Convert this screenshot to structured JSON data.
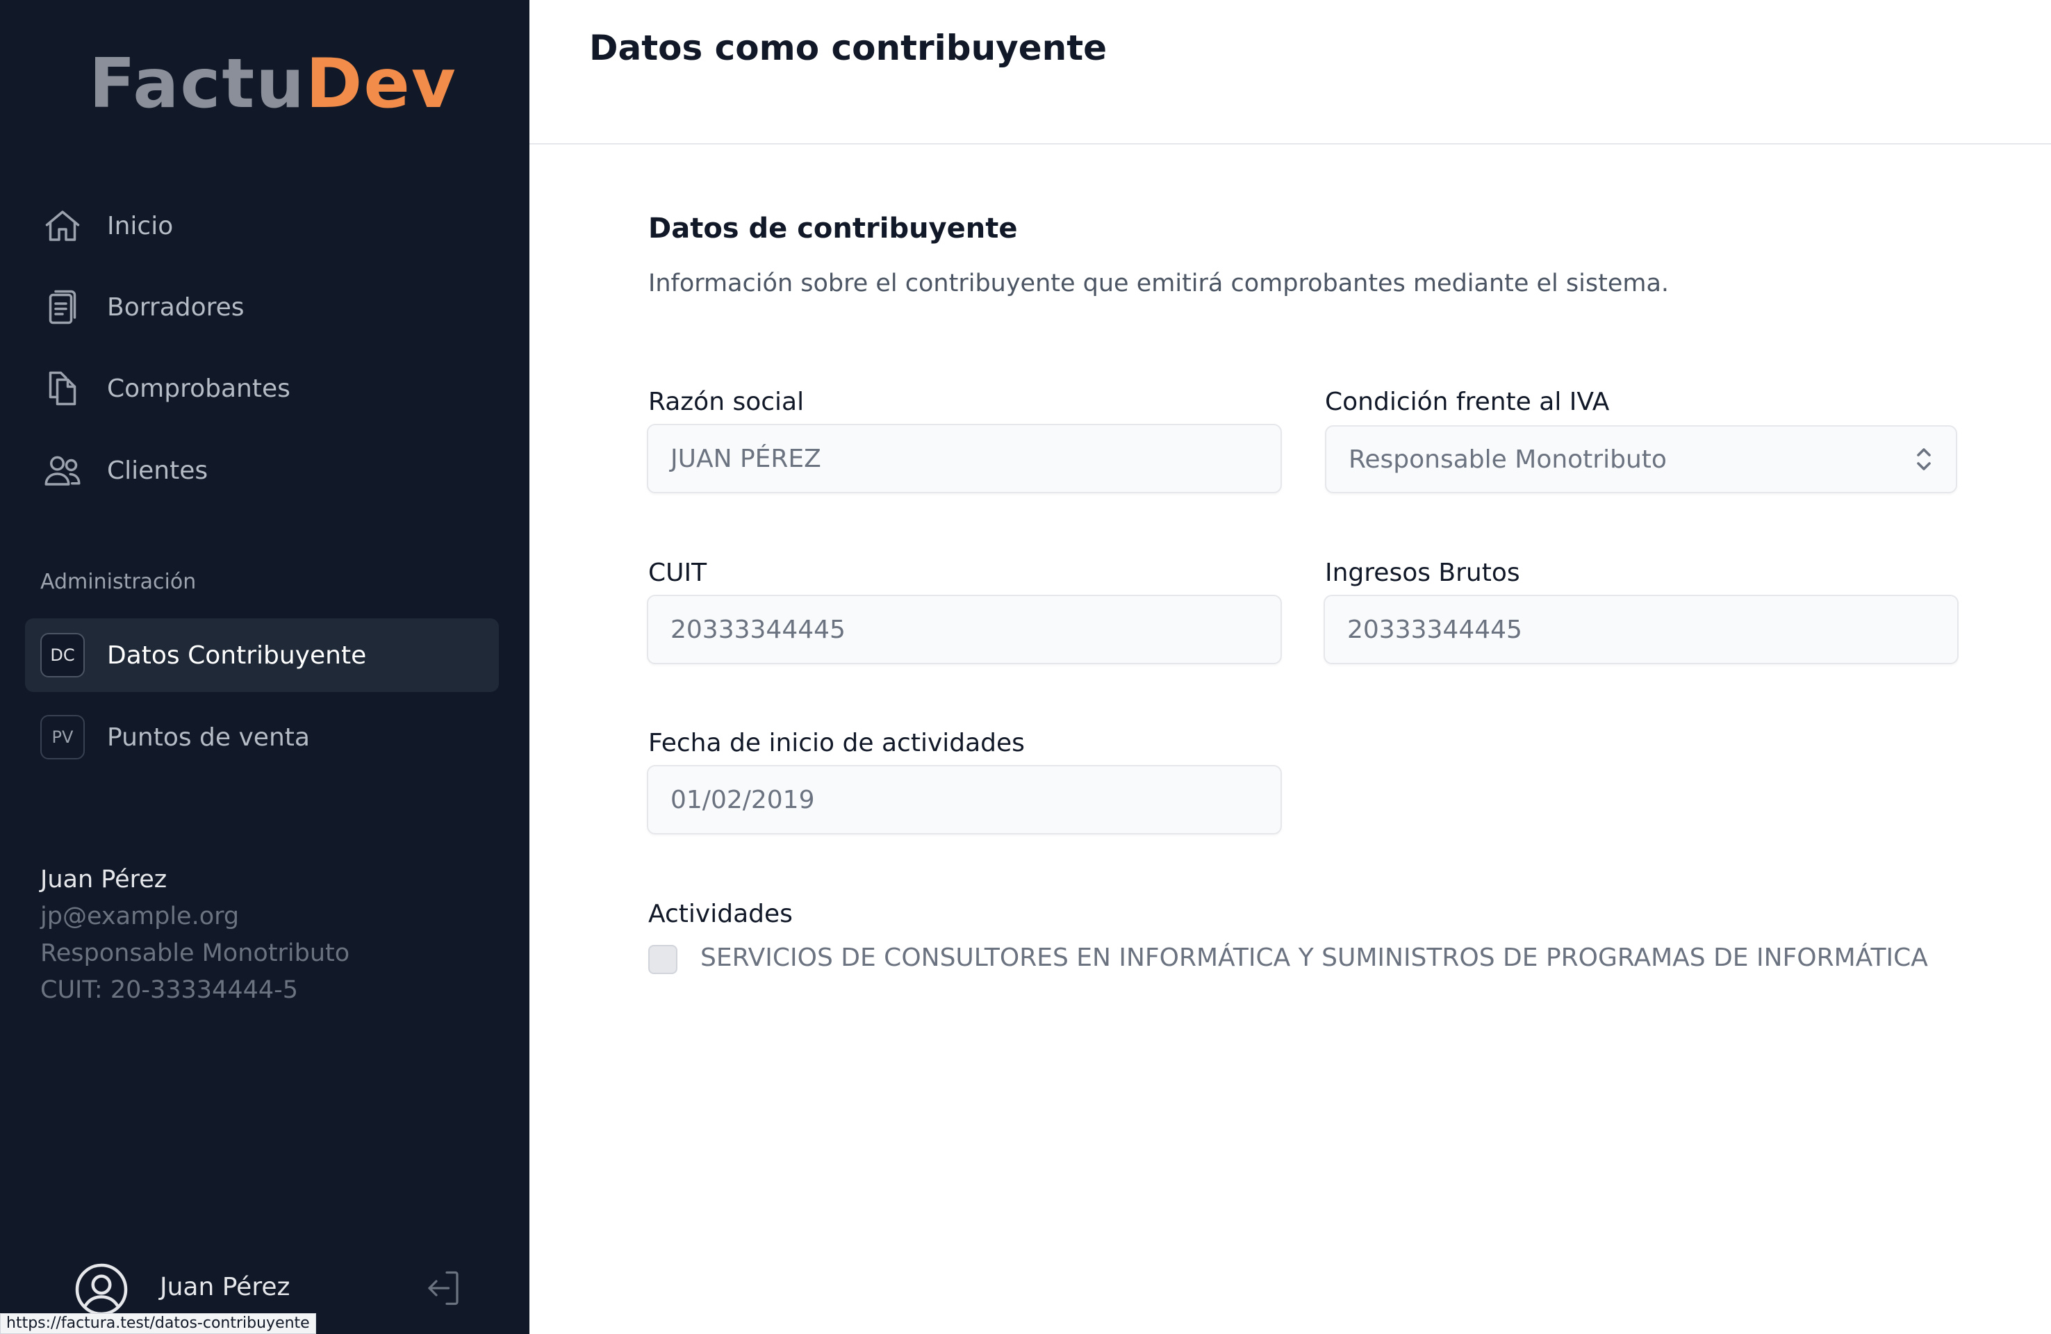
{
  "brand": {
    "part1": "Factu",
    "part2": "Dev",
    "color1": "#8a8f99",
    "color2": "#f28c4a"
  },
  "sidebar": {
    "nav": [
      {
        "label": "Inicio",
        "icon": "home-icon"
      },
      {
        "label": "Borradores",
        "icon": "clipboard-icon"
      },
      {
        "label": "Comprobantes",
        "icon": "documents-icon"
      },
      {
        "label": "Clientes",
        "icon": "users-icon"
      }
    ],
    "section_label": "Administración",
    "admin": [
      {
        "badge": "DC",
        "label": "Datos Contribuyente",
        "active": true
      },
      {
        "badge": "PV",
        "label": "Puntos de venta",
        "active": false
      }
    ],
    "user": {
      "name": "Juan Pérez",
      "email": "jp@example.org",
      "condition": "Responsable Monotributo",
      "cuit": "CUIT: 20-33334444-5"
    },
    "footer": {
      "name": "Juan Pérez"
    }
  },
  "header": {
    "title": "Datos como contribuyente"
  },
  "form": {
    "title": "Datos de contribuyente",
    "description": "Información sobre el contribuyente que emitirá comprobantes mediante el sistema.",
    "razon_social": {
      "label": "Razón social",
      "value": "JUAN PÉREZ"
    },
    "condicion_iva": {
      "label": "Condición frente al IVA",
      "value": "Responsable Monotributo"
    },
    "cuit": {
      "label": "CUIT",
      "value": "20333344445"
    },
    "ingresos_brutos": {
      "label": "Ingresos Brutos",
      "value": "20333344445"
    },
    "fecha_inicio": {
      "label": "Fecha de inicio de actividades",
      "value": "01/02/2019"
    },
    "actividades": {
      "label": "Actividades",
      "items": [
        {
          "label": "SERVICIOS DE CONSULTORES EN INFORMÁTICA Y SUMINISTROS DE PROGRAMAS DE INFORMÁTICA",
          "checked": false
        }
      ]
    }
  },
  "status_url": "https://factura.test/datos-contribuyente"
}
